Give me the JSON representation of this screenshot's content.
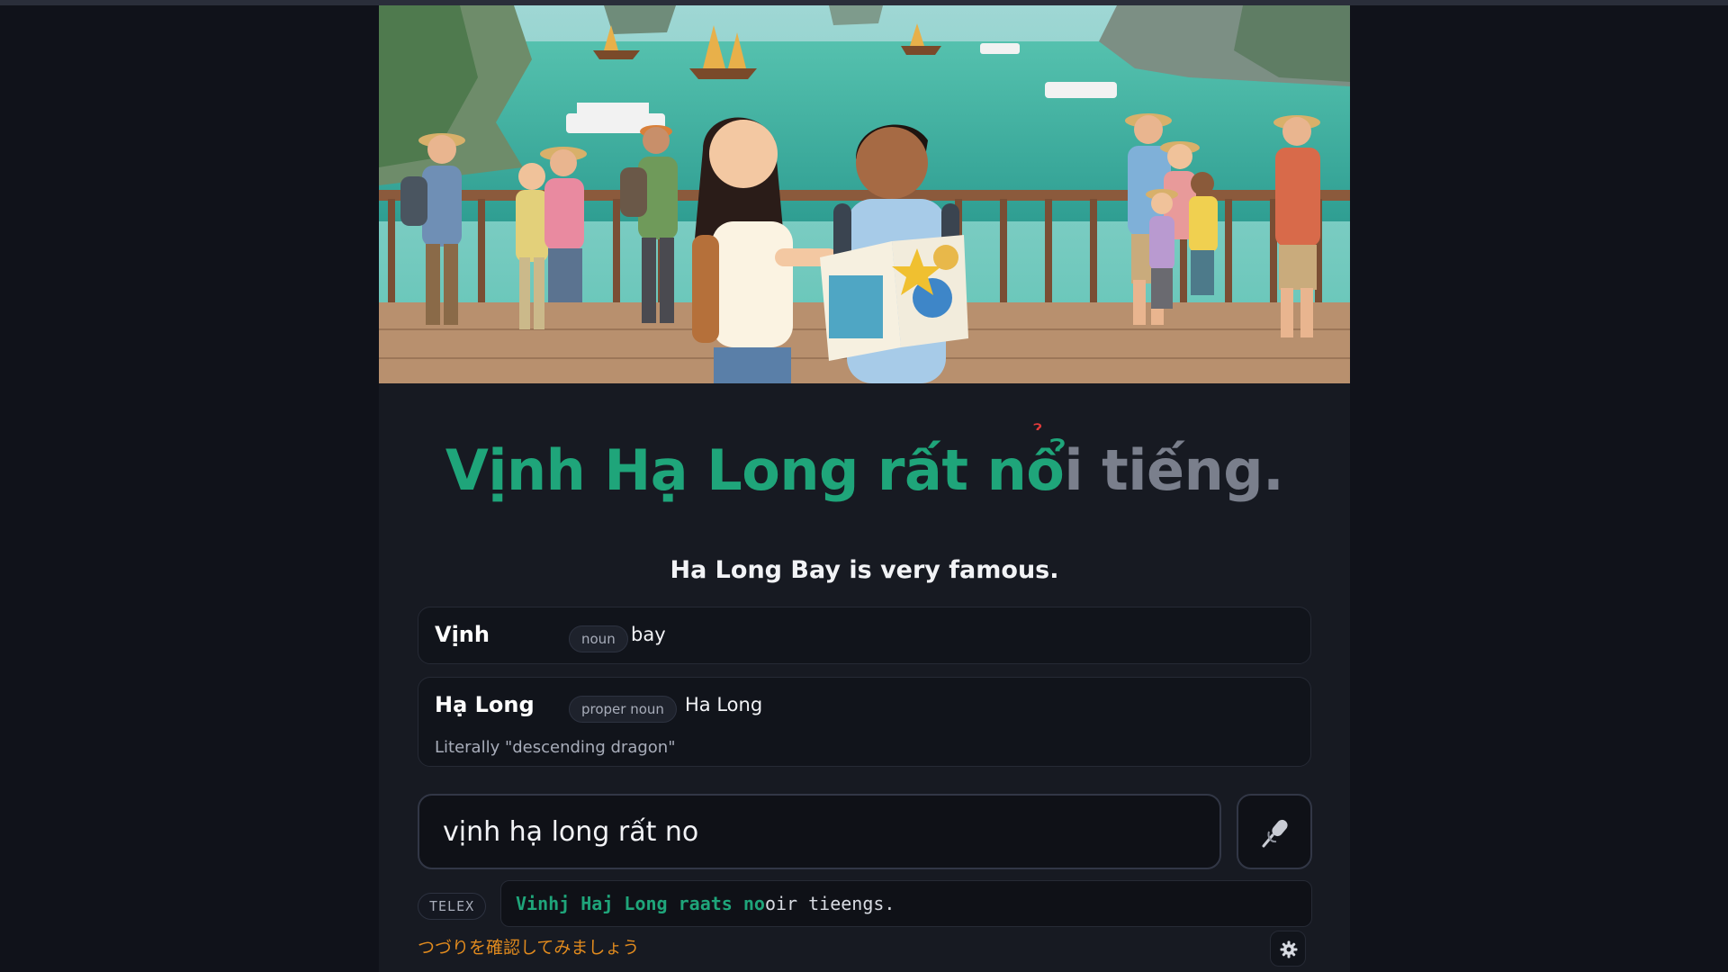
{
  "lesson": {
    "sentence_done": "Vịnh Hạ Long rất n",
    "sentence_current": "ổ",
    "sentence_current_mark": "̉",
    "sentence_rest": "i tiếng.",
    "translation": "Ha Long Bay is very famous."
  },
  "glossary": [
    {
      "word": "Vịnh",
      "pos": "noun",
      "meaning": "bay",
      "note": ""
    },
    {
      "word": "Hạ Long",
      "pos": "proper noun",
      "meaning": "Ha Long",
      "note": "Literally \"descending dragon\""
    }
  ],
  "answer": {
    "value": "vịnh hạ long rất no",
    "placeholder": ""
  },
  "telex": {
    "label": "TELEX",
    "typed": "Vinhj Haj Long raats no",
    "remaining": "oir tieengs."
  },
  "hint": "つづりを確認してみましょう",
  "icons": {
    "mic": "microphone-icon",
    "settings": "gear-icon"
  },
  "colors": {
    "accent": "#1fa57a",
    "error_mark": "#e23b3b",
    "hint": "#e08a1e"
  }
}
